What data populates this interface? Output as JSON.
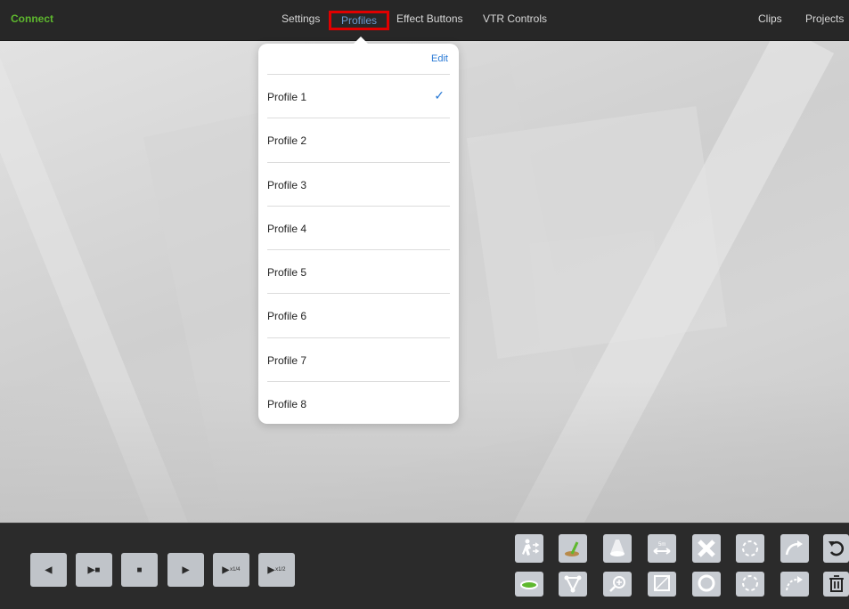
{
  "topbar": {
    "connect": "Connect",
    "tabs": [
      "Settings",
      "Profiles",
      "Effect Buttons",
      "VTR Controls"
    ],
    "right": [
      "Clips",
      "Projects"
    ]
  },
  "popover": {
    "edit_label": "Edit",
    "profiles": [
      "Profile 1",
      "Profile 2",
      "Profile 3",
      "Profile 4",
      "Profile 5",
      "Profile 6",
      "Profile 7",
      "Profile 8"
    ],
    "selected_index": 0,
    "check_glyph": "✓"
  },
  "transport": {
    "buttons": [
      {
        "icon": "step-back-icon",
        "glyph": "◀"
      },
      {
        "icon": "play-pause-icon",
        "glyph": "▶■"
      },
      {
        "icon": "stop-icon",
        "glyph": "■"
      },
      {
        "icon": "play-icon",
        "glyph": "▶"
      },
      {
        "icon": "slow-quarter-icon",
        "glyph": "▶",
        "sub": "x1/4"
      },
      {
        "icon": "slow-half-icon",
        "glyph": "▶",
        "sub": "x1/2"
      }
    ]
  },
  "effects": {
    "row1": [
      "player-move-icon",
      "ground-marker-icon",
      "spotlight-icon",
      "distance-5m-icon",
      "delete-x-icon",
      "dashed-circle-icon",
      "curved-arrow-icon",
      "undo-icon"
    ],
    "row2": [
      "green-disc-icon",
      "connect-triangle-icon",
      "zoom-icon",
      "square-icon",
      "circle-ring-icon",
      "dashed-circle-icon",
      "dashed-arrow-icon",
      "trash-icon"
    ],
    "distance_label": "5m"
  },
  "colors": {
    "connect": "#5eb82e",
    "active_tab": "#6d9bd0",
    "highlight_border": "#e00000",
    "accent_blue": "#2a7ad6"
  }
}
